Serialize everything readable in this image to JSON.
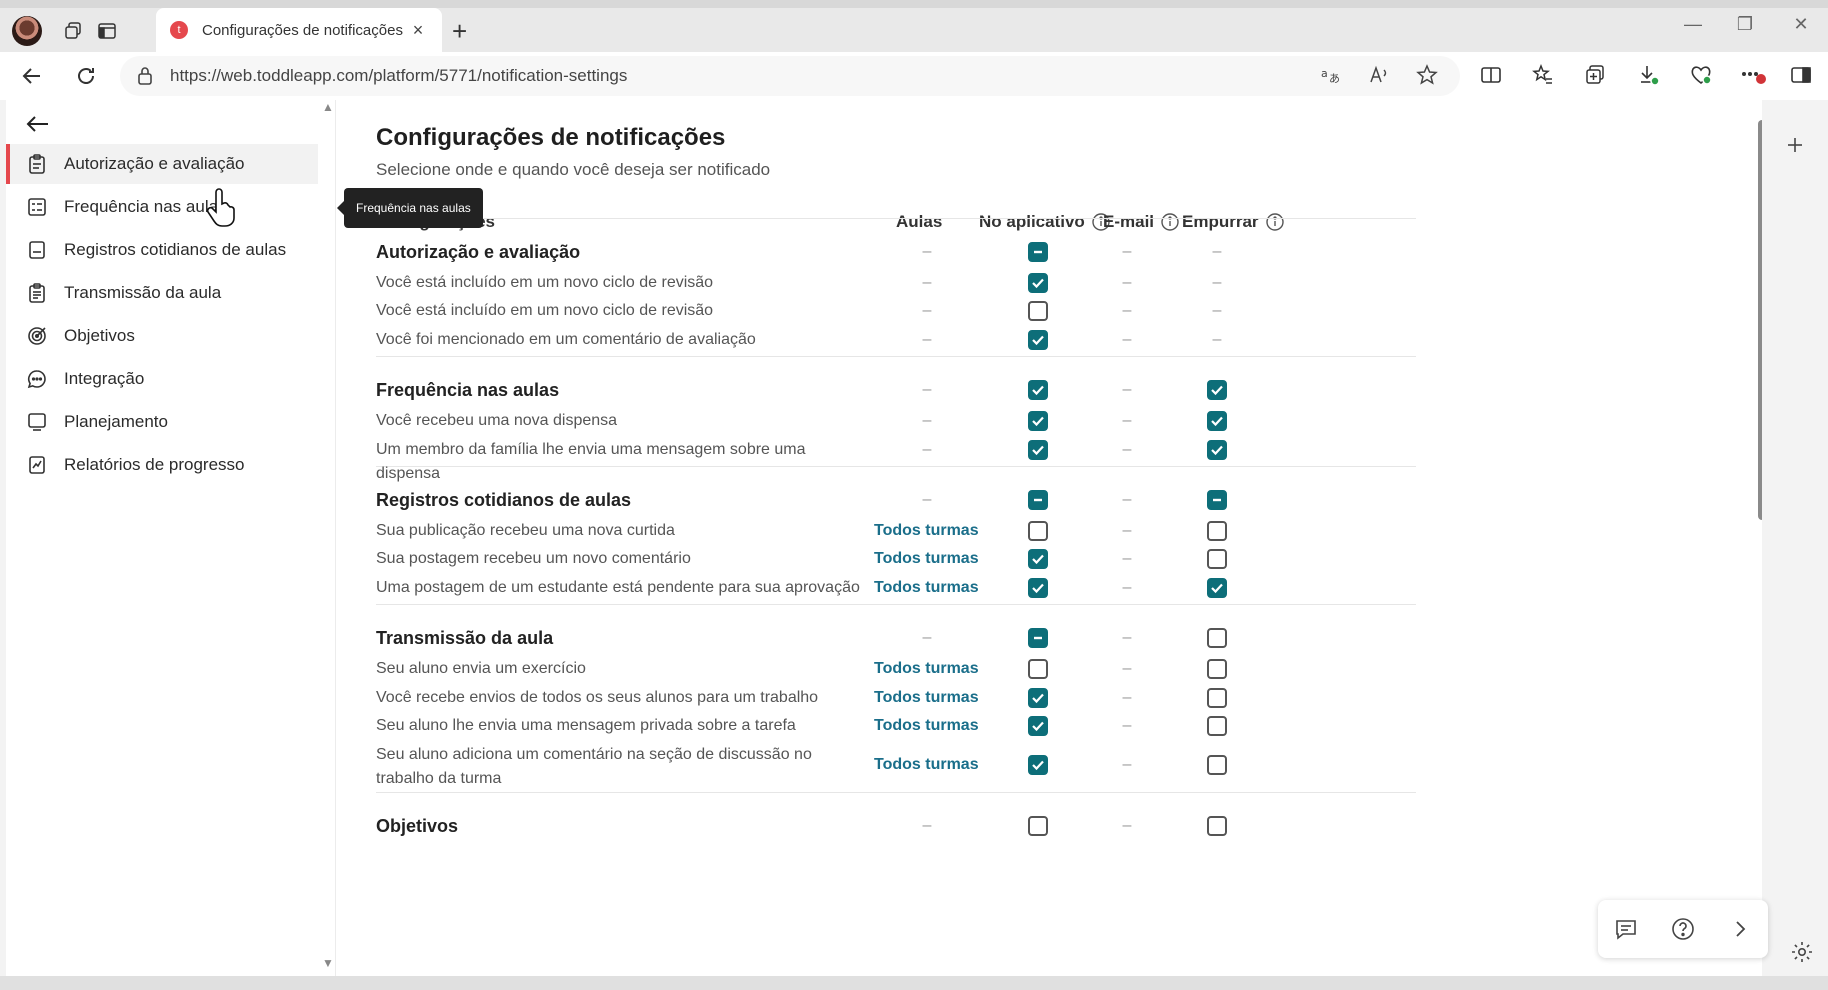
{
  "browser": {
    "tab_title": "Configurações de notificações",
    "tab_favicon": "t",
    "url": "https://web.toddleapp.com/platform/5771/notification-settings"
  },
  "sidebar": {
    "items": [
      {
        "label": "Autorização e avaliação",
        "icon": "clipboard-icon",
        "active": true
      },
      {
        "label": "Frequência nas aulas",
        "icon": "list-board-icon",
        "active": false
      },
      {
        "label": "Registros cotidianos de aulas",
        "icon": "document-icon",
        "active": false
      },
      {
        "label": "Transmissão da aula",
        "icon": "clipboard-lines-icon",
        "active": false
      },
      {
        "label": "Objetivos",
        "icon": "target-icon",
        "active": false
      },
      {
        "label": "Integração",
        "icon": "chat-bubble-icon",
        "active": false
      },
      {
        "label": "Planejamento",
        "icon": "monitor-icon",
        "active": false
      },
      {
        "label": "Relatórios de progresso",
        "icon": "chart-report-icon",
        "active": false
      }
    ],
    "tooltip": "Frequência nas aulas"
  },
  "main": {
    "title": "Configurações de notificações",
    "subtitle": "Selecione onde e quando você deseja ser notificado",
    "columns": {
      "settings": "Configurações",
      "classes": "Aulas",
      "in_app": "No aplicativo",
      "email": "E-mail",
      "push": "Empurrar"
    },
    "dash": "–",
    "link_label": "Todos turmas",
    "rows": [
      {
        "label": "Autorização e avaliação",
        "group": true,
        "classes": "-",
        "in_app": "partial",
        "email": "-",
        "push": "-"
      },
      {
        "label": "Você está incluído em um novo ciclo de revisão",
        "group": false,
        "classes": "-",
        "in_app": "checked",
        "email": "-",
        "push": "-"
      },
      {
        "label": "Você está incluído em um novo ciclo de revisão",
        "group": false,
        "classes": "-",
        "in_app": "unchecked",
        "email": "-",
        "push": "-"
      },
      {
        "label": "Você foi mencionado em um comentário de avaliação",
        "group": false,
        "classes": "-",
        "in_app": "checked",
        "email": "-",
        "push": "-"
      },
      {
        "label": "Frequência nas aulas",
        "group": true,
        "classes": "-",
        "in_app": "checked",
        "email": "-",
        "push": "checked"
      },
      {
        "label": "Você recebeu uma nova dispensa",
        "group": false,
        "classes": "-",
        "in_app": "checked",
        "email": "-",
        "push": "checked"
      },
      {
        "label": "Um membro da família lhe envia uma mensagem sobre uma dispensa",
        "group": false,
        "classes": "-",
        "in_app": "checked",
        "email": "-",
        "push": "checked"
      },
      {
        "label": "Registros cotidianos de aulas",
        "group": true,
        "classes": "-",
        "in_app": "partial",
        "email": "-",
        "push": "partial"
      },
      {
        "label": "Sua publicação recebeu uma nova curtida",
        "group": false,
        "classes": "link",
        "in_app": "unchecked",
        "email": "-",
        "push": "unchecked"
      },
      {
        "label": "Sua postagem recebeu um novo comentário",
        "group": false,
        "classes": "link",
        "in_app": "checked",
        "email": "-",
        "push": "unchecked"
      },
      {
        "label": "Uma postagem de um estudante está pendente para sua aprovação",
        "group": false,
        "classes": "link",
        "in_app": "checked",
        "email": "-",
        "push": "checked"
      },
      {
        "label": "Transmissão da aula",
        "group": true,
        "classes": "-",
        "in_app": "partial",
        "email": "-",
        "push": "unchecked"
      },
      {
        "label": "Seu aluno envia um exercício",
        "group": false,
        "classes": "link",
        "in_app": "unchecked",
        "email": "-",
        "push": "unchecked"
      },
      {
        "label": "Você recebe envios de todos os seus alunos para um trabalho",
        "group": false,
        "classes": "link",
        "in_app": "checked",
        "email": "-",
        "push": "unchecked"
      },
      {
        "label": "Seu aluno lhe envia uma mensagem privada sobre a tarefa",
        "group": false,
        "classes": "link",
        "in_app": "checked",
        "email": "-",
        "push": "unchecked"
      },
      {
        "label": "Seu aluno adiciona um comentário na seção de discussão no trabalho da turma",
        "group": false,
        "classes": "link",
        "in_app": "checked",
        "email": "-",
        "push": "unchecked"
      },
      {
        "label": "Objetivos",
        "group": true,
        "classes": "-",
        "in_app": "unchecked",
        "email": "-",
        "push": "unchecked"
      }
    ]
  },
  "colors": {
    "accent": "#0d6e79",
    "link": "#1a6e8a",
    "active_marker": "#e5484d"
  }
}
